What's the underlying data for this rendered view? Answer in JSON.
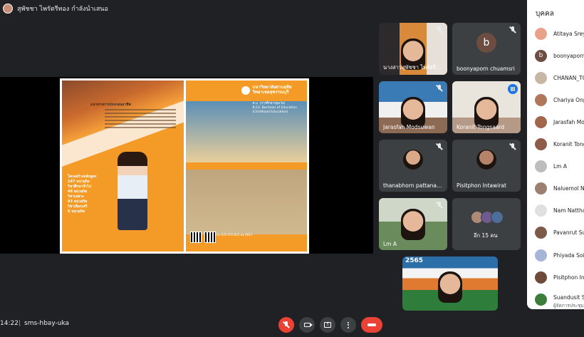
{
  "topbar": {
    "presenting_text": "สุพัชชา ไพรัตรีทอง กำลังนำเสนอ"
  },
  "slide": {
    "left_heading": "แนวทางการประกอบอาชีพ",
    "stats": [
      "โครงสร้างหลักสูตร",
      "147 หน่วยกิต",
      "วิชาศึกษาทั่วไป",
      "48 หน่วยกิต",
      "วิชาเฉพาะ",
      "93 หน่วยกิต",
      "วิชาเลือกเสรี",
      "6 หน่วยกิต"
    ],
    "university": "มหาวิทยาลัยสวนดุสิต",
    "campus": "วิทยาเขตสุพรรณบุรี",
    "degree_th": "ค.บ. (การศึกษาปฐมวัย)",
    "degree_en": "B.Ed. Bachelor of Education (Childhood Education)",
    "contact": "โทร 035-455-825 ต่อ 4613"
  },
  "tiles": [
    {
      "name": "นางสาวสุพัชชา ไพรัตรีทอง",
      "muted": true,
      "type": "video"
    },
    {
      "name": "boonyaporn chuamsri",
      "muted": true,
      "type": "avatar",
      "initial": "b",
      "color": "#6d4c41"
    },
    {
      "name": "Jarasfah Modsuwan",
      "muted": true,
      "type": "video"
    },
    {
      "name": "Koranit Tongsaard",
      "muted": false,
      "speaking": true,
      "type": "video"
    },
    {
      "name": "thanabhorn pattanawong",
      "muted": true,
      "type": "video"
    },
    {
      "name": "Pisitphon Intawirat",
      "muted": false,
      "type": "video"
    },
    {
      "name": "Lm A",
      "muted": true,
      "type": "video"
    },
    {
      "name": "อีก 15 คน",
      "muted": false,
      "type": "more"
    }
  ],
  "self_tile": {
    "banner": "2565"
  },
  "bottombar": {
    "clock": "14:22",
    "separator": "|",
    "meeting_code": "sms-hbay-uka",
    "present_glyph": "↑"
  },
  "people_panel": {
    "title": "บุคคล",
    "people": [
      {
        "name": "Atitaya Sreyo",
        "initial": "",
        "color": "#e8a28a"
      },
      {
        "name": "boonyaporn chuamsri",
        "initial": "b",
        "color": "#6d4c41"
      },
      {
        "name": "CHANAN_TONGPROM",
        "initial": "",
        "color": "#c9b7a6"
      },
      {
        "name": "Chariya Onpan",
        "initial": "",
        "color": "#b0775a"
      },
      {
        "name": "Jarasfah Modsuwan",
        "initial": "",
        "color": "#a2674b"
      },
      {
        "name": "Koranit Tongsaard",
        "initial": "",
        "color": "#8e5d4a"
      },
      {
        "name": "Lm A",
        "initial": "",
        "color": "#bdbdbd"
      },
      {
        "name": "Naluemol Nilsuk",
        "initial": "",
        "color": "#9c7f70"
      },
      {
        "name": "Nam Natthawat",
        "initial": "",
        "color": "#e0e0e0"
      },
      {
        "name": "Pavanrut Suwan",
        "initial": "",
        "color": "#7d5a48"
      },
      {
        "name": "Phiyada Soisong",
        "initial": "",
        "color": "#a6b4d8"
      },
      {
        "name": "Pisitphon Intawirat",
        "initial": "",
        "color": "#6f4a3a"
      },
      {
        "name": "Suandusit Suphanburi",
        "sub": "ผู้จัดการประชุม",
        "initial": "",
        "color": "#3b7d3a"
      }
    ]
  }
}
